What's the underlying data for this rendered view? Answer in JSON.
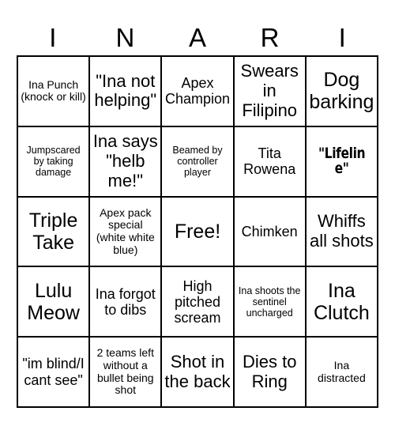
{
  "card": {
    "header_letters": [
      "I",
      "N",
      "A",
      "R",
      "I"
    ],
    "rows": [
      [
        {
          "text": "Ina Punch (knock or kill)",
          "size": "sm"
        },
        {
          "text": "\"Ina not helping\"",
          "size": "lg"
        },
        {
          "text": "Apex Champion",
          "size": "md"
        },
        {
          "text": "Swears in Filipino",
          "size": "lg"
        },
        {
          "text": "Dog barking",
          "size": "xl"
        }
      ],
      [
        {
          "text": "Jumpscared by taking damage",
          "size": "xs"
        },
        {
          "text": "Ina says \"helb me!\"",
          "size": "lg"
        },
        {
          "text": "Beamed by controller player",
          "size": "xs"
        },
        {
          "text": "Tita Rowena",
          "size": "md"
        },
        {
          "text": "\"Lifeline\"",
          "size": "impact"
        }
      ],
      [
        {
          "text": "Triple Take",
          "size": "xl"
        },
        {
          "text": "Apex pack special (white white blue)",
          "size": "sm"
        },
        {
          "text": "Free!",
          "size": "xl"
        },
        {
          "text": "Chimken",
          "size": "md"
        },
        {
          "text": "Whiffs all shots",
          "size": "lg"
        }
      ],
      [
        {
          "text": "Lulu Meow",
          "size": "xl"
        },
        {
          "text": "Ina forgot to dibs",
          "size": "md"
        },
        {
          "text": "High pitched scream",
          "size": "md"
        },
        {
          "text": "Ina shoots the sentinel uncharged",
          "size": "xs"
        },
        {
          "text": "Ina Clutch",
          "size": "xl"
        }
      ],
      [
        {
          "text": "\"im blind/I cant see\"",
          "size": "md"
        },
        {
          "text": "2 teams left without a bullet being shot",
          "size": "sm"
        },
        {
          "text": "Shot in the back",
          "size": "lg"
        },
        {
          "text": "Dies to Ring",
          "size": "lg"
        },
        {
          "text": "Ina distracted",
          "size": "sm"
        }
      ]
    ]
  },
  "colors": {
    "background": "#ffffff",
    "border": "#000000",
    "text": "#000000"
  }
}
